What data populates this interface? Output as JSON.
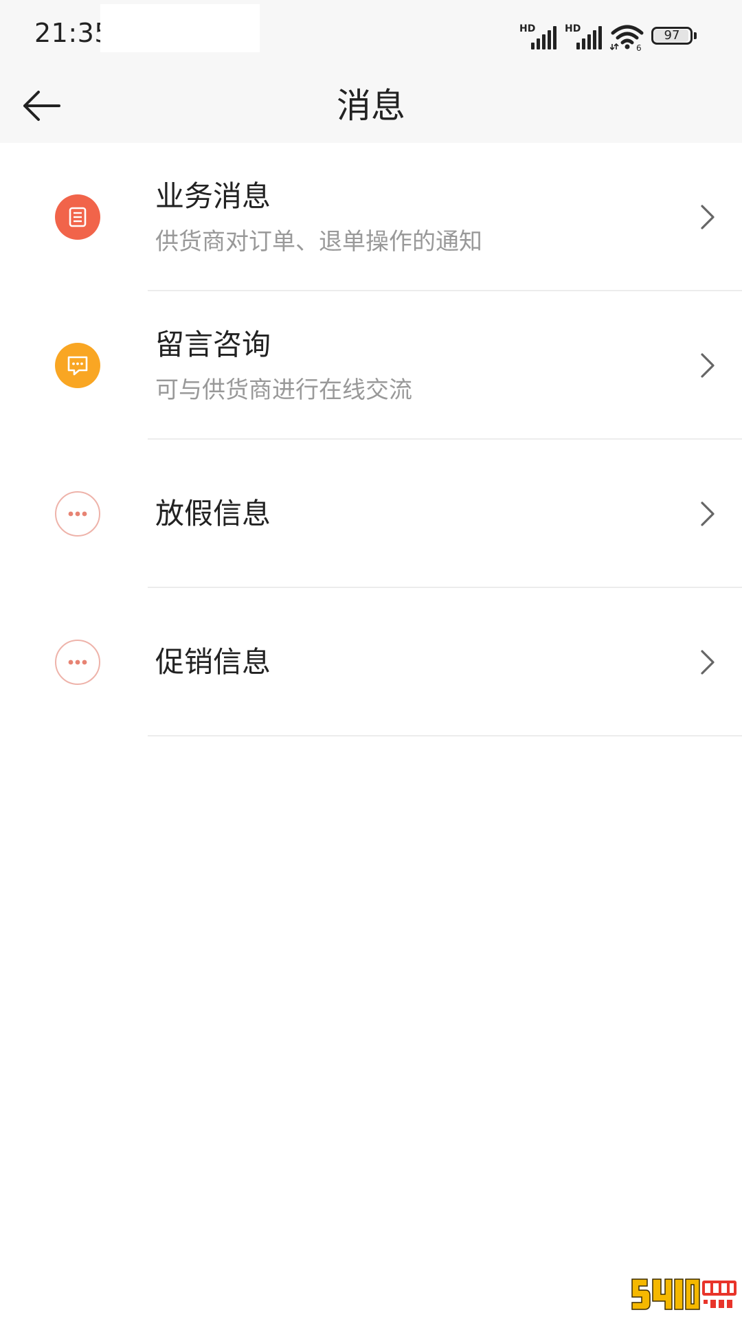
{
  "status_bar": {
    "time": "21:35",
    "battery_level": "97",
    "signal_1_label": "HD",
    "signal_2_label": "HD",
    "wifi_label": "6"
  },
  "header": {
    "title": "消息",
    "back_icon": "arrow-left-icon"
  },
  "messages": [
    {
      "title": "业务消息",
      "subtitle": "供货商对订单、退单操作的通知",
      "icon": "document-icon",
      "icon_color": "#f1644a"
    },
    {
      "title": "留言咨询",
      "subtitle": "可与供货商进行在线交流",
      "icon": "chat-bubble-icon",
      "icon_color": "#f9a623"
    },
    {
      "title": "放假信息",
      "subtitle": "",
      "icon": "more-dots-icon",
      "icon_color": "#e78373"
    },
    {
      "title": "促销信息",
      "subtitle": "",
      "icon": "more-dots-icon",
      "icon_color": "#e78373"
    }
  ],
  "colors": {
    "header_bg": "#f7f7f7",
    "text_primary": "#222222",
    "text_secondary": "#999999",
    "divider": "#ececec"
  }
}
